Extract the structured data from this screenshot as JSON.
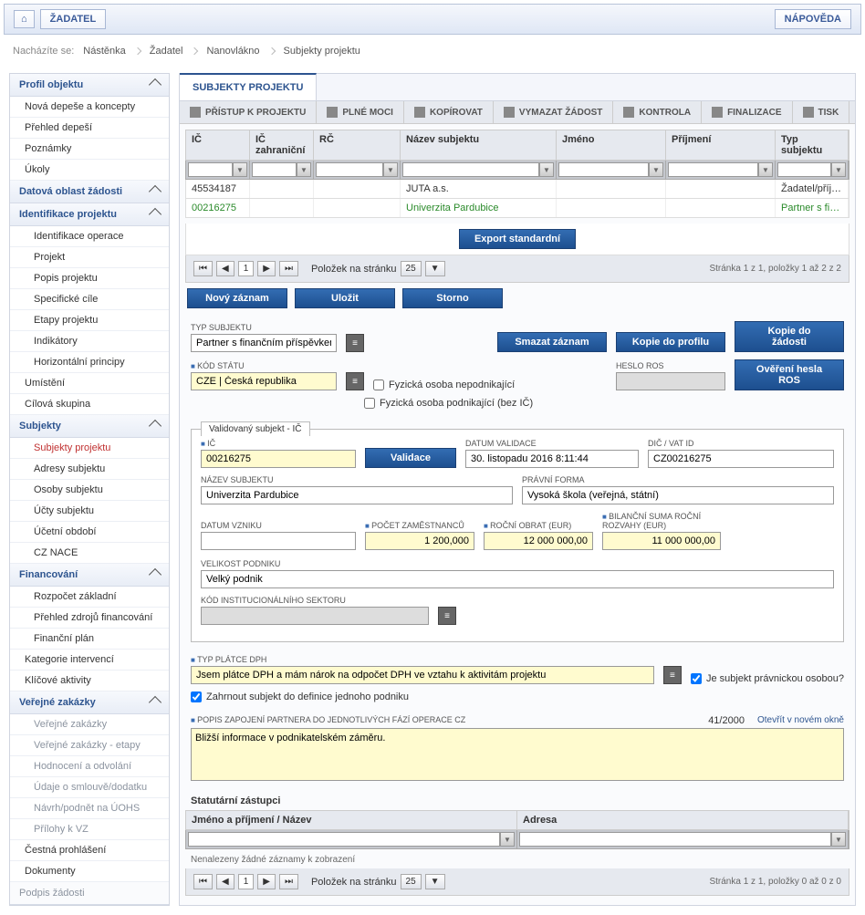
{
  "top": {
    "zadatel": "ŽADATEL",
    "napoveda": "NÁPOVĚDA"
  },
  "breadcrumb": {
    "label": "Nacházíte se:",
    "c1": "Nástěnka",
    "c2": "Žadatel",
    "c3": "Nanovlákno",
    "c4": "Subjekty projektu"
  },
  "sidebar": {
    "s1": "Profil objektu",
    "s1i": [
      "Nová depeše a koncepty",
      "Přehled depeší",
      "Poznámky",
      "Úkoly"
    ],
    "s2": "Datová oblast žádosti",
    "s3": "Identifikace projektu",
    "s3i": [
      "Identifikace operace",
      "Projekt",
      "Popis projektu",
      "Specifické cíle",
      "Etapy projektu",
      "Indikátory",
      "Horizontální principy"
    ],
    "s3b": [
      "Umístění",
      "Cílová skupina"
    ],
    "s4": "Subjekty",
    "s4i": [
      "Subjekty projektu",
      "Adresy subjektu",
      "Osoby subjektu",
      "Účty subjektu",
      "Účetní období",
      "CZ NACE"
    ],
    "s5": "Financování",
    "s5i": [
      "Rozpočet základní",
      "Přehled zdrojů financování",
      "Finanční plán"
    ],
    "s5b": [
      "Kategorie intervencí",
      "Klíčové aktivity"
    ],
    "s6": "Veřejné zakázky",
    "s6i": [
      "Veřejné zakázky",
      "Veřejné zakázky - etapy",
      "Hodnocení a odvolání",
      "Údaje o smlouvě/dodatku",
      "Návrh/podnět na ÚOHS",
      "Přílohy k VZ"
    ],
    "s6b": [
      "Čestná prohlášení",
      "Dokumenty"
    ],
    "s7": "Podpis žádosti"
  },
  "main": {
    "tab": "SUBJEKTY PROJEKTU",
    "toolbar": [
      "PŘÍSTUP K PROJEKTU",
      "PLNÉ MOCI",
      "KOPÍROVAT",
      "VYMAZAT ŽÁDOST",
      "KONTROLA",
      "FINALIZACE",
      "TISK"
    ],
    "gridHdr": {
      "ic": "IČ",
      "icz": "IČ zahraniční",
      "rc": "RČ",
      "naz": "Název subjektu",
      "jm": "Jméno",
      "pr": "Příjmení",
      "typ": "Typ subjektu"
    },
    "rows": [
      {
        "ic": "45534187",
        "naz": "JUTA a.s.",
        "typ": "Žadatel/příjem..."
      },
      {
        "ic": "00216275",
        "naz": "Univerzita Pardubice",
        "typ": "Partner s fina..."
      }
    ],
    "export": "Export standardní",
    "pager": {
      "page": "1",
      "pps": "Položek na stránku",
      "ppv": "25",
      "info": "Stránka 1 z 1, položky 1 až 2 z 2"
    },
    "btns": {
      "novy": "Nový záznam",
      "ulozit": "Uložit",
      "storno": "Storno",
      "smazat": "Smazat záznam",
      "kopieP": "Kopie do profilu",
      "kopieZ": "Kopie do žádosti",
      "overeni": "Ověření hesla ROS",
      "validace": "Validace"
    },
    "form": {
      "typSubjLbl": "TYP SUBJEKTU",
      "typSubj": "Partner s finančním příspěvkem",
      "kodStatuLbl": "KÓD STÁTU",
      "kodStatu": "CZE | Česká republika",
      "fyzNepodn": "Fyzická osoba nepodnikající",
      "fyzPodn": "Fyzická osoba podnikající (bez IČ)",
      "hesloRosLbl": "HESLO ROS",
      "fsTitle": "Validovaný subjekt - IČ",
      "icLbl": "IČ",
      "ic": "00216275",
      "datumValLbl": "DATUM VALIDACE",
      "datumVal": "30. listopadu 2016 8:11:44",
      "dicLbl": "DIČ / VAT ID",
      "dic": "CZ00216275",
      "nazevLbl": "NÁZEV SUBJEKTU",
      "nazev": "Univerzita Pardubice",
      "pravniLbl": "PRÁVNÍ FORMA",
      "pravni": "Vysoká škola (veřejná, státní)",
      "datumVznLbl": "DATUM VZNIKU",
      "pocetZamLbl": "POČET ZAMĚSTNANCŮ",
      "pocetZam": "1 200,000",
      "obratLbl": "ROČNÍ OBRAT (EUR)",
      "obrat": "12 000 000,00",
      "bilancLbl": "BILANČNÍ SUMA ROČNÍ ROZVAHY (EUR)",
      "bilanc": "11 000 000,00",
      "velikostLbl": "VELIKOST PODNIKU",
      "velikost": "Velký podnik",
      "kodInstLbl": "KÓD INSTITUCIONÁLNÍHO SEKTORU",
      "typPlatceLbl": "TYP PLÁTCE DPH",
      "typPlatce": "Jsem plátce DPH a mám nárok na odpočet DPH ve vztahu k aktivitám projektu",
      "jePravnicka": "Je subjekt právnickou osobou?",
      "zahrnout": "Zahrnout subjekt do definice jednoho podniku",
      "popisLbl": "POPIS ZAPOJENÍ PARTNERA DO JEDNOTLIVÝCH FÁZÍ OPERACE CZ",
      "popisCount": "41/2000",
      "popisLink": "Otevřít v novém okně",
      "popis": "Bližší informace v podnikatelském záměru.",
      "statTitle": "Statutární zástupci",
      "statH1": "Jméno a příjmení / Název",
      "statH2": "Adresa",
      "noRec": "Nenalezeny žádné záznamy k zobrazení",
      "pager2info": "Stránka 1 z 1, položky 0 až 0 z 0"
    }
  }
}
